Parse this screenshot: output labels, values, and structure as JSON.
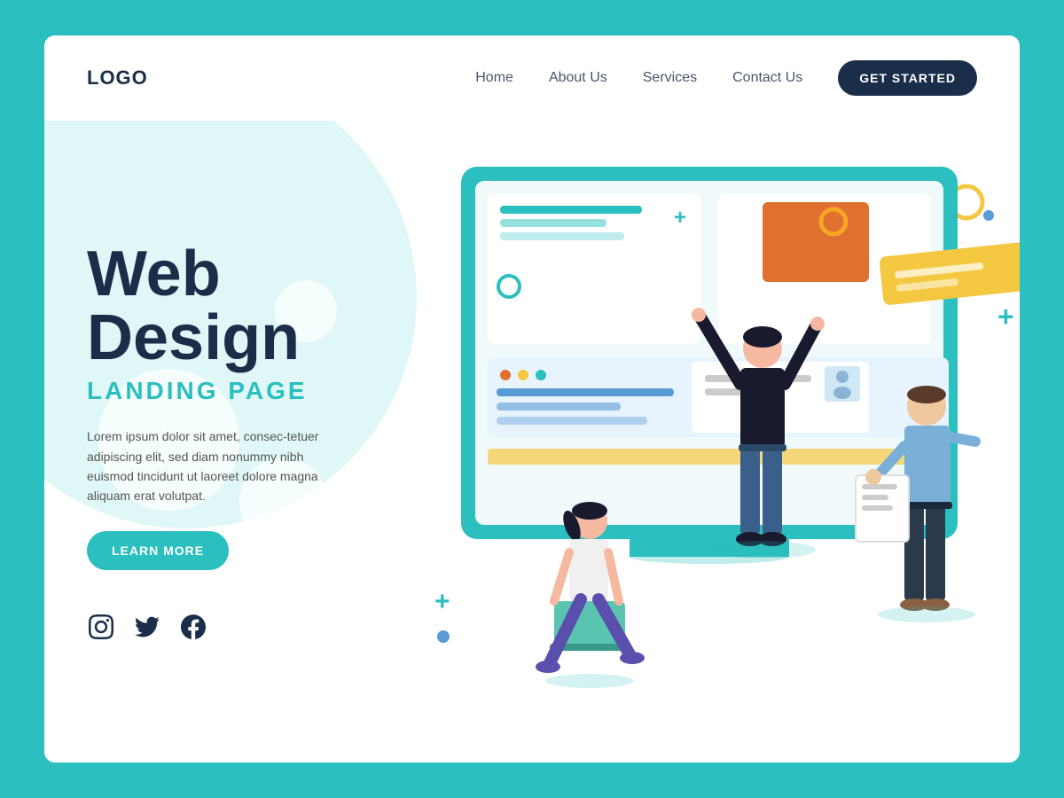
{
  "header": {
    "logo": "LOGO",
    "nav": {
      "home": "Home",
      "about": "About Us",
      "services": "Services",
      "contact": "Contact Us",
      "cta": "GET STARTED"
    }
  },
  "hero": {
    "title_line1": "Web",
    "title_line2": "Design",
    "subtitle": "LANDING PAGE",
    "description": "Lorem ipsum dolor sit amet, consec-tetuer adipiscing elit, sed diam nonummy nibh euismod tincidunt ut laoreet dolore magna aliquam erat volutpat.",
    "cta": "LEARN MORE"
  },
  "social": {
    "instagram": "instagram-icon",
    "twitter": "twitter-icon",
    "facebook": "facebook-icon"
  },
  "colors": {
    "teal": "#2bbfbf",
    "dark_navy": "#1a2e4a",
    "orange": "#e07030",
    "yellow": "#f5c842",
    "blue": "#5b9bd5",
    "light_bg": "#e0f7f7"
  }
}
